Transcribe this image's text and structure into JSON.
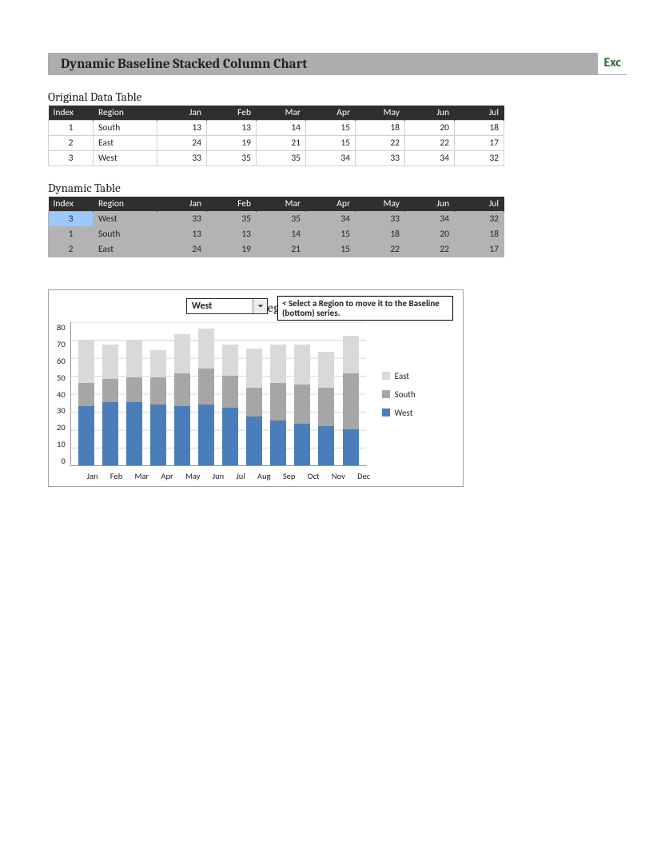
{
  "title_bar": {
    "title": "Dynamic Baseline Stacked Column Chart",
    "corner_label": "Exc"
  },
  "tables": {
    "original": {
      "heading": "Original Data Table",
      "columns": [
        "Index",
        "Region",
        "Jan",
        "Feb",
        "Mar",
        "Apr",
        "May",
        "Jun",
        "Jul"
      ],
      "rows": [
        {
          "index": "1",
          "region": "South",
          "vals": [
            13,
            13,
            14,
            15,
            18,
            20,
            18
          ]
        },
        {
          "index": "2",
          "region": "East",
          "vals": [
            24,
            19,
            21,
            15,
            22,
            22,
            17
          ]
        },
        {
          "index": "3",
          "region": "West",
          "vals": [
            33,
            35,
            35,
            34,
            33,
            34,
            32
          ]
        }
      ]
    },
    "dynamic": {
      "heading": "Dynamic Table",
      "columns": [
        "Index",
        "Region",
        "Jan",
        "Feb",
        "Mar",
        "Apr",
        "May",
        "Jun",
        "Jul"
      ],
      "selected_index": "3",
      "rows": [
        {
          "index": "3",
          "region": "West",
          "vals": [
            33,
            35,
            35,
            34,
            33,
            34,
            32
          ]
        },
        {
          "index": "1",
          "region": "South",
          "vals": [
            13,
            13,
            14,
            15,
            18,
            20,
            18
          ]
        },
        {
          "index": "2",
          "region": "East",
          "vals": [
            24,
            19,
            21,
            15,
            22,
            22,
            17
          ]
        }
      ]
    }
  },
  "chart": {
    "dropdown_value": "West",
    "hint_text": "< Select a Region to move it to the Baseline (bottom) series.",
    "title_text": "Sales by Region"
  },
  "chart_data": {
    "type": "bar",
    "stacked": true,
    "title": "Sales by Region",
    "xlabel": "",
    "ylabel": "",
    "ylim": [
      0,
      80
    ],
    "yticks": [
      0,
      10,
      20,
      30,
      40,
      50,
      60,
      70,
      80
    ],
    "legend_position": "right",
    "categories": [
      "Jan",
      "Feb",
      "Mar",
      "Apr",
      "May",
      "Jun",
      "Jul",
      "Aug",
      "Sep",
      "Oct",
      "Nov",
      "Dec"
    ],
    "series": [
      {
        "name": "West",
        "color": "#4a7ebb",
        "values": [
          33,
          35,
          35,
          34,
          33,
          34,
          32,
          27,
          25,
          23,
          22,
          20
        ]
      },
      {
        "name": "South",
        "color": "#a6a6a6",
        "values": [
          13,
          13,
          14,
          15,
          18,
          20,
          18,
          16,
          21,
          22,
          21,
          31
        ]
      },
      {
        "name": "East",
        "color": "#d9d9d9",
        "values": [
          24,
          19,
          21,
          15,
          22,
          22,
          17,
          22,
          21,
          22,
          20,
          21
        ]
      }
    ]
  }
}
